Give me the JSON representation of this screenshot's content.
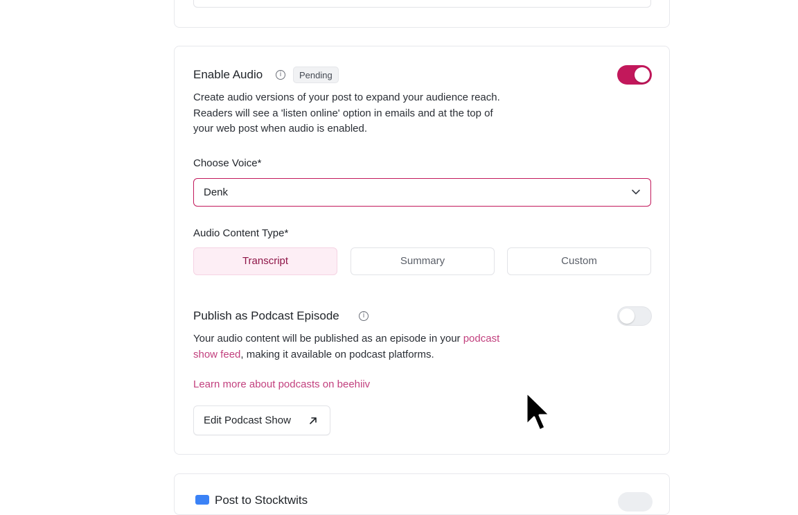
{
  "audio": {
    "title": "Enable Audio",
    "status_badge": "Pending",
    "enabled": true,
    "description_lines": [
      "Create audio versions of your post to expand your audience reach.",
      "Readers will see a 'listen online' option in emails and at the top of",
      "your web post when audio is enabled."
    ],
    "voice_label": "Choose Voice*",
    "voice_value": "Denk",
    "content_type_label": "Audio Content Type*",
    "content_types": [
      "Transcript",
      "Summary",
      "Custom"
    ],
    "selected_content_type": "Transcript"
  },
  "podcast": {
    "title": "Publish as Podcast Episode",
    "enabled": false,
    "desc_prefix": "Your audio content will be published as an episode in your ",
    "desc_link_1": "podcast",
    "desc_link_2": "show feed",
    "desc_suffix": ", making it available on podcast platforms.",
    "learn_more": "Learn more about podcasts on beehiiv",
    "edit_button": "Edit Podcast Show"
  },
  "next_section": {
    "title": "Post to Stocktwits"
  },
  "colors": {
    "accent": "#c2185b",
    "link": "#c2407e",
    "active_segment_bg": "#fdeef5"
  }
}
